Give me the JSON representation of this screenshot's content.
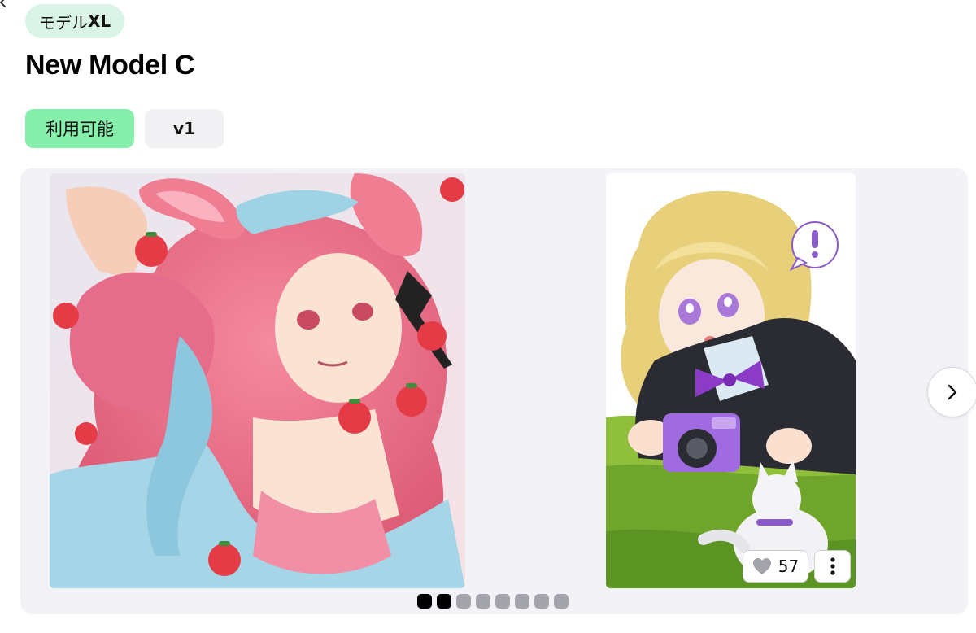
{
  "header": {
    "model_tag_prefix": "モデル",
    "model_tag_suffix": "XL",
    "title": "New Model C",
    "status": "利用可能",
    "version": "v1"
  },
  "carousel": {
    "slides": [
      {
        "subject": "girl with bunny ears, pink hair and strawberries"
      },
      {
        "subject": "blonde girl lying on grass holding a purple camera with a white cat"
      }
    ],
    "likes": "57",
    "dot_count": 8,
    "active_dots": [
      0,
      1
    ]
  },
  "icons": {
    "heart": "heart-icon",
    "more": "more-vertical-icon",
    "next": "chevron-right-icon"
  },
  "colors": {
    "status_bg": "#86efac",
    "model_tag_bg": "#d9f3e6",
    "carousel_bg": "#f3f2f7"
  }
}
